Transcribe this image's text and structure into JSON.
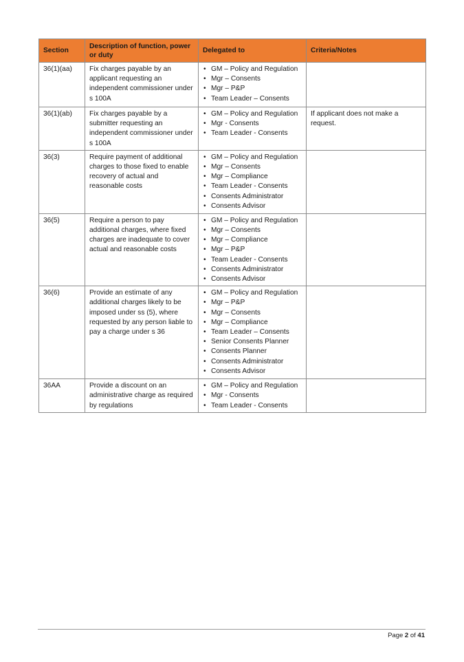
{
  "table": {
    "headers": [
      "Section",
      "Description of function, power or duty",
      "Delegated to",
      "Criteria/Notes"
    ],
    "header_color": "#ed7d31",
    "rows": [
      {
        "section": "36(1)(aa)",
        "description": "Fix charges payable by an applicant requesting an independent commissioner under s 100A",
        "delegated_to": [
          "GM – Policy and Regulation",
          "Mgr – Consents",
          "Mgr – P&P",
          "Team Leader – Consents"
        ],
        "notes": ""
      },
      {
        "section": "36(1)(ab)",
        "description": "Fix charges payable by a submitter requesting an independent commissioner under s 100A",
        "delegated_to": [
          "GM – Policy and Regulation",
          "Mgr - Consents",
          "Team Leader - Consents"
        ],
        "notes": "If applicant does not make a request."
      },
      {
        "section": "36(3)",
        "description": "Require payment of additional charges to those fixed to enable recovery of actual and reasonable costs",
        "delegated_to": [
          "GM – Policy and Regulation",
          "Mgr – Consents",
          "Mgr – Compliance",
          "Team Leader - Consents",
          "Consents Administrator",
          "Consents Advisor"
        ],
        "notes": ""
      },
      {
        "section": "36(5)",
        "description": "Require a person to pay additional charges, where fixed charges are inadequate to cover actual and reasonable costs",
        "delegated_to": [
          "GM – Policy and Regulation",
          "Mgr – Consents",
          "Mgr – Compliance",
          "Mgr – P&P",
          "Team Leader - Consents",
          "Consents Administrator",
          "Consents Advisor"
        ],
        "notes": ""
      },
      {
        "section": "36(6)",
        "description": "Provide an estimate of any additional charges likely to be imposed under ss (5), where requested by any person liable to pay a charge under s 36",
        "delegated_to": [
          "GM – Policy and Regulation",
          "Mgr – P&P",
          "Mgr – Consents",
          "Mgr – Compliance",
          "Team Leader – Consents",
          "Senior Consents Planner",
          "Consents Planner",
          "Consents Administrator",
          "Consents Advisor"
        ],
        "notes": ""
      },
      {
        "section": "36AA",
        "description": "Provide a discount on an administrative charge as required by regulations",
        "delegated_to": [
          "GM – Policy and Regulation",
          "Mgr - Consents",
          "Team Leader - Consents"
        ],
        "notes": ""
      }
    ]
  },
  "footer": {
    "page_prefix": "Page",
    "page_current": "2",
    "page_of": "of",
    "page_total": "41"
  }
}
